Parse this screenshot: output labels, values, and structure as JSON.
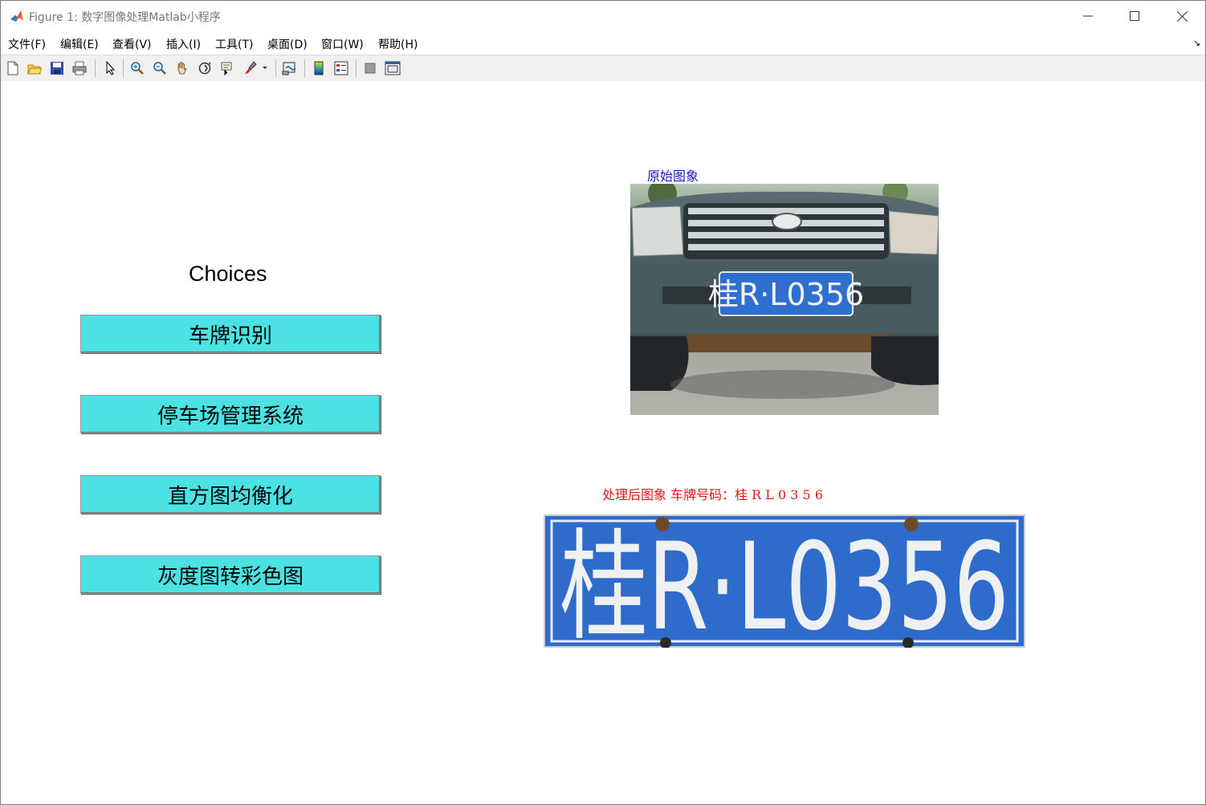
{
  "window": {
    "title": "Figure 1: 数字图像处理Matlab小程序"
  },
  "menu": [
    {
      "label": "文件(F)"
    },
    {
      "label": "编辑(E)"
    },
    {
      "label": "查看(V)"
    },
    {
      "label": "插入(I)"
    },
    {
      "label": "工具(T)"
    },
    {
      "label": "桌面(D)"
    },
    {
      "label": "窗口(W)"
    },
    {
      "label": "帮助(H)"
    }
  ],
  "toolbar": [
    {
      "icon": "new-figure-icon"
    },
    {
      "icon": "open-file-icon"
    },
    {
      "icon": "save-icon"
    },
    {
      "icon": "print-icon"
    },
    {
      "icon": "edit-plot-arrow-icon"
    },
    {
      "icon": "zoom-in-icon"
    },
    {
      "icon": "zoom-out-icon"
    },
    {
      "icon": "pan-hand-icon"
    },
    {
      "icon": "rotate-3d-icon"
    },
    {
      "icon": "data-cursor-icon"
    },
    {
      "icon": "brush-icon"
    },
    {
      "icon": "link-plot-icon"
    },
    {
      "icon": "insert-colorbar-icon"
    },
    {
      "icon": "insert-legend-icon"
    },
    {
      "icon": "hide-plot-tools-icon"
    },
    {
      "icon": "show-plot-tools-icon"
    }
  ],
  "panel": {
    "title": "Choices",
    "buttons": [
      {
        "label": "车牌识别"
      },
      {
        "label": "停车场管理系统"
      },
      {
        "label": "直方图均衡化"
      },
      {
        "label": "灰度图转彩色图"
      }
    ],
    "button_color": "#4ce2e4"
  },
  "images": {
    "original_title": "原始图象",
    "processed_title": "处理后图象 车牌号码：桂 R L 0 3 5 6",
    "plate_text": "桂R·L0356",
    "original_title_color": "#1a1acc",
    "processed_title_color": "#e01818",
    "plate_color": "#2f6fcf"
  }
}
